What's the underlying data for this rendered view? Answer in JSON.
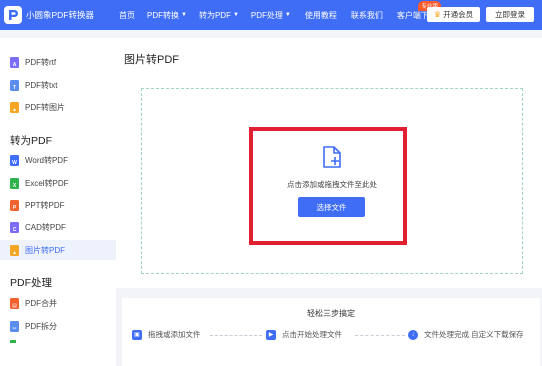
{
  "header": {
    "app_name": "小圆象PDF转换器",
    "nav": [
      {
        "label": "首页",
        "caret": false
      },
      {
        "label": "PDF转换",
        "caret": true
      },
      {
        "label": "转为PDF",
        "caret": true
      },
      {
        "label": "PDF处理",
        "caret": true
      },
      {
        "label": "使用教程",
        "caret": false
      },
      {
        "label": "联系我们",
        "caret": false
      },
      {
        "label": "客户端下载",
        "caret": false,
        "badge": "专业版"
      }
    ],
    "vip_button": "开通会员",
    "login_button": "立即登录",
    "colors": {
      "header_bg": "#3f6df5"
    }
  },
  "sidebar": {
    "pdf_to_items": [
      {
        "label": "PDF转rtf",
        "icon": "rtf-file-icon",
        "color": "#7b6cf6"
      },
      {
        "label": "PDF转txt",
        "icon": "txt-file-icon",
        "color": "#5b8def"
      },
      {
        "label": "PDF转图片",
        "icon": "image-file-icon",
        "color": "#f5a623"
      }
    ],
    "to_pdf_title": "转为PDF",
    "to_pdf_items": [
      {
        "label": "Word转PDF",
        "icon": "word-file-icon",
        "color": "#3f6df5",
        "letter": "W"
      },
      {
        "label": "Excel转PDF",
        "icon": "excel-file-icon",
        "color": "#2fb24c",
        "letter": "X"
      },
      {
        "label": "PPT转PDF",
        "icon": "ppt-file-icon",
        "color": "#f2622e",
        "letter": "P"
      },
      {
        "label": "CAD转PDF",
        "icon": "cad-file-icon",
        "color": "#7b6cf6",
        "letter": "C"
      },
      {
        "label": "图片转PDF",
        "icon": "image-file-icon",
        "color": "#f5a623",
        "letter": "",
        "active": true
      }
    ],
    "process_title": "PDF处理",
    "process_items": [
      {
        "label": "PDF合并",
        "icon": "merge-file-icon",
        "color": "#f2622e"
      },
      {
        "label": "PDF拆分",
        "icon": "split-file-icon",
        "color": "#5b8def"
      }
    ]
  },
  "main": {
    "title": "图片转PDF",
    "upload_hint": "点击添加或拖拽文件至此处",
    "select_button": "选择文件",
    "steps_title": "轻松三步搞定",
    "steps": [
      {
        "label": "拖拽或添加文件",
        "icon": "add-file-icon"
      },
      {
        "label": "点击开始处理文件",
        "icon": "process-icon"
      },
      {
        "label": "文件处理完成 自定义下载保存",
        "icon": "download-icon"
      }
    ]
  }
}
